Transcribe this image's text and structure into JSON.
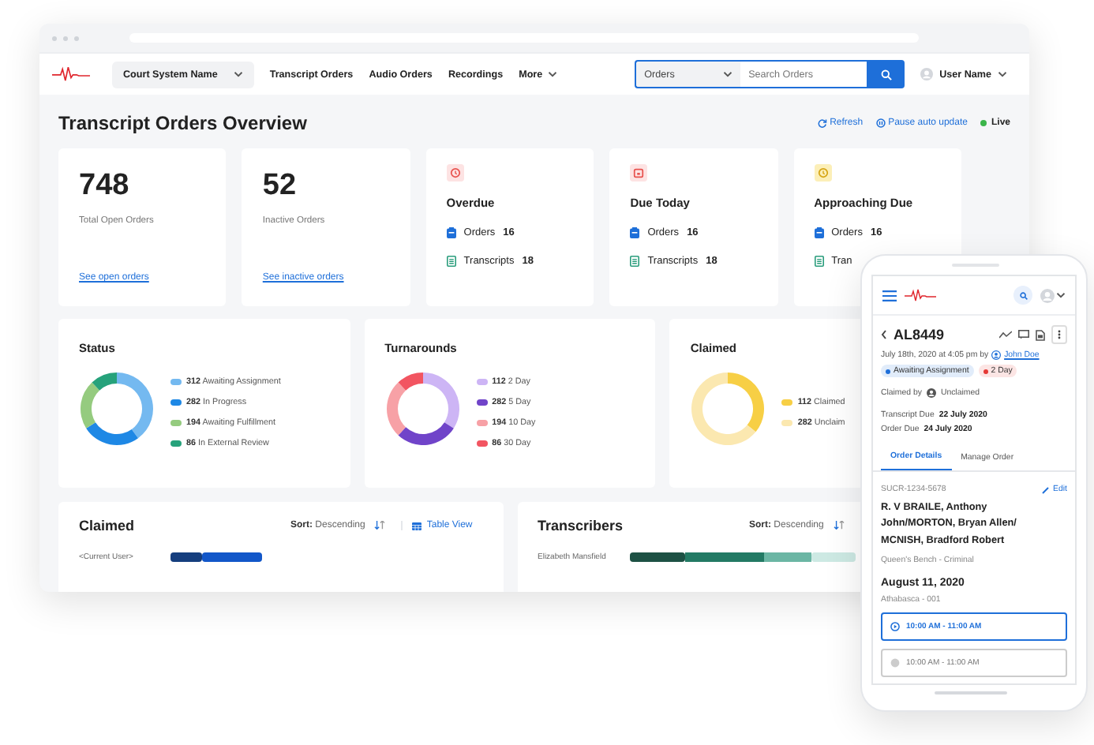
{
  "nav": {
    "court_select": "Court System Name",
    "links": [
      "Transcript Orders",
      "Audio Orders",
      "Recordings"
    ],
    "more": "More",
    "search": {
      "scope": "Orders",
      "placeholder": "Search Orders"
    },
    "user": "User Name"
  },
  "header": {
    "title": "Transcript Orders Overview",
    "refresh": "Refresh",
    "pause": "Pause auto update",
    "live": "Live"
  },
  "totals": [
    {
      "value": "748",
      "label": "Total Open Orders",
      "link": "See open orders"
    },
    {
      "value": "52",
      "label": "Inactive Orders",
      "link": "See inactive orders"
    }
  ],
  "due_cards": [
    {
      "kind": "overdue",
      "title": "Overdue",
      "rows": [
        {
          "kind": "orders",
          "label": "Orders",
          "count": "16"
        },
        {
          "kind": "transcripts",
          "label": "Transcripts",
          "count": "18"
        }
      ]
    },
    {
      "kind": "due_today",
      "title": "Due Today",
      "rows": [
        {
          "kind": "orders",
          "label": "Orders",
          "count": "16"
        },
        {
          "kind": "transcripts",
          "label": "Transcripts",
          "count": "18"
        }
      ]
    },
    {
      "kind": "approaching",
      "title": "Approaching Due",
      "rows": [
        {
          "kind": "orders",
          "label": "Orders",
          "count": "16"
        },
        {
          "kind": "transcripts",
          "label": "Tran"
        }
      ]
    }
  ],
  "donut_cards": [
    {
      "title": "Status",
      "chart_data": {
        "type": "donut",
        "values": [
          40,
          26,
          22,
          12
        ]
      },
      "legend": [
        {
          "count": "312",
          "label": "Awaiting Assignment",
          "color": "#74b9f0"
        },
        {
          "count": "282",
          "label": "In Progress",
          "color": "#1e88e5"
        },
        {
          "count": "194",
          "label": "Awaiting Fulfillment",
          "color": "#95cb7f"
        },
        {
          "count": "86",
          "label": "In External Review",
          "color": "#26a27b"
        }
      ]
    },
    {
      "title": "Turnarounds",
      "chart_data": {
        "type": "donut",
        "values": [
          34,
          28,
          26,
          12
        ]
      },
      "legend": [
        {
          "count": "112",
          "label": "2 Day",
          "color": "#cdb5f5"
        },
        {
          "count": "282",
          "label": "5 Day",
          "color": "#7044c9"
        },
        {
          "count": "194",
          "label": "10 Day",
          "color": "#f7a1a6"
        },
        {
          "count": "86",
          "label": "30 Day",
          "color": "#f25561"
        }
      ]
    },
    {
      "title": "Claimed",
      "chart_data": {
        "type": "donut",
        "values": [
          36,
          64
        ]
      },
      "legend": [
        {
          "count": "112",
          "label": "Claimed",
          "color": "#f7cf45"
        },
        {
          "count": "282",
          "label": "Unclaim",
          "color": "#fbe8b0"
        }
      ]
    }
  ],
  "lists": [
    {
      "kind": "claimed",
      "title": "Claimed",
      "sort_label": "Sort:",
      "sort_value": "Descending",
      "view": "Table View",
      "rows": [
        {
          "name": "<Current User>"
        }
      ]
    },
    {
      "kind": "transcribers",
      "title": "Transcribers",
      "sort_label": "Sort:",
      "sort_value": "Descending",
      "rows": [
        {
          "name": "Elizabeth Mansfield"
        }
      ]
    }
  ],
  "phone": {
    "order_id": "AL8449",
    "created": "July 18th, 2020 at 4:05 pm by",
    "author": "John Doe",
    "badges": [
      {
        "label": "Awaiting Assignment",
        "color": "#1e6fd9"
      },
      {
        "label": "2 Day",
        "color": "#e53935"
      }
    ],
    "claimed_label": "Claimed by",
    "claimed_value": "Unclaimed",
    "dates": [
      {
        "label": "Transcript Due",
        "value": "22 July 2020"
      },
      {
        "label": "Order Due",
        "value": "24 July 2020"
      }
    ],
    "tabs": [
      {
        "label": "Order Details",
        "selected": true
      },
      {
        "label": "Manage Order",
        "selected": false
      }
    ],
    "case_number": "SUCR-1234-5678",
    "edit": "Edit",
    "parties": "R. V BRAILE, Anthony John/MORTON, Bryan Allen/ MCNISH, Bradford Robert",
    "court": "Queen's Bench - Criminal",
    "date": "August 11, 2020",
    "location": "Athabasca - 001",
    "slots": [
      {
        "label": "10:00 AM - 11:00 AM",
        "selected": true
      },
      {
        "label": "10:00 AM - 11:00 AM",
        "selected": false
      }
    ]
  }
}
